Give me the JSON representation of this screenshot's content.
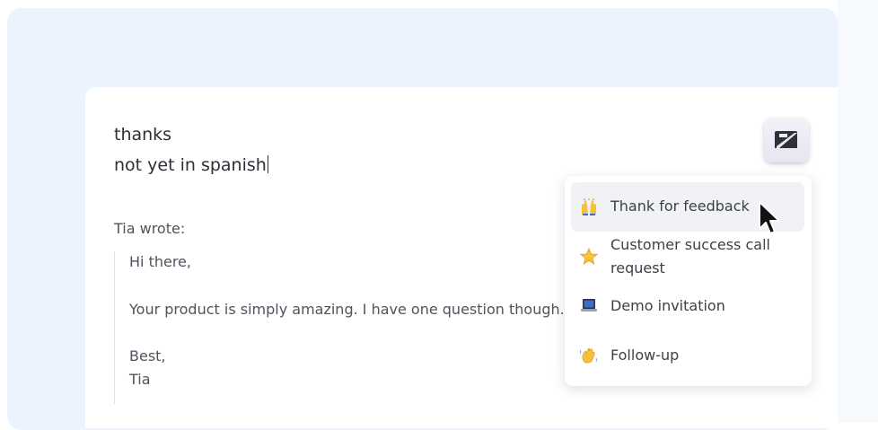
{
  "reply": {
    "line1": "thanks",
    "line2": "not yet in spanish"
  },
  "quoted": {
    "attribution": "Tia wrote:",
    "greeting": "Hi there,",
    "body": "Your product is simply amazing. I have one question though.",
    "closing": "Best,",
    "signature": "Tia"
  },
  "compose_button": {
    "icon": "quick-reply-icon"
  },
  "template_menu": {
    "items": [
      {
        "emoji": "raising-hands-icon",
        "label": "Thank for feedback",
        "hovered": true
      },
      {
        "emoji": "star-icon",
        "label_line1": "Customer success call",
        "label_line2": "request"
      },
      {
        "emoji": "laptop-icon",
        "label": "Demo invitation"
      },
      {
        "emoji": "waving-hand-icon",
        "label": "Follow-up"
      }
    ]
  },
  "colors": {
    "background_panel": "#ebf4fe",
    "card": "#ffffff",
    "text_primary": "#2d2f36",
    "text_secondary": "#50535c",
    "menu_hover": "#f1f2f5"
  }
}
